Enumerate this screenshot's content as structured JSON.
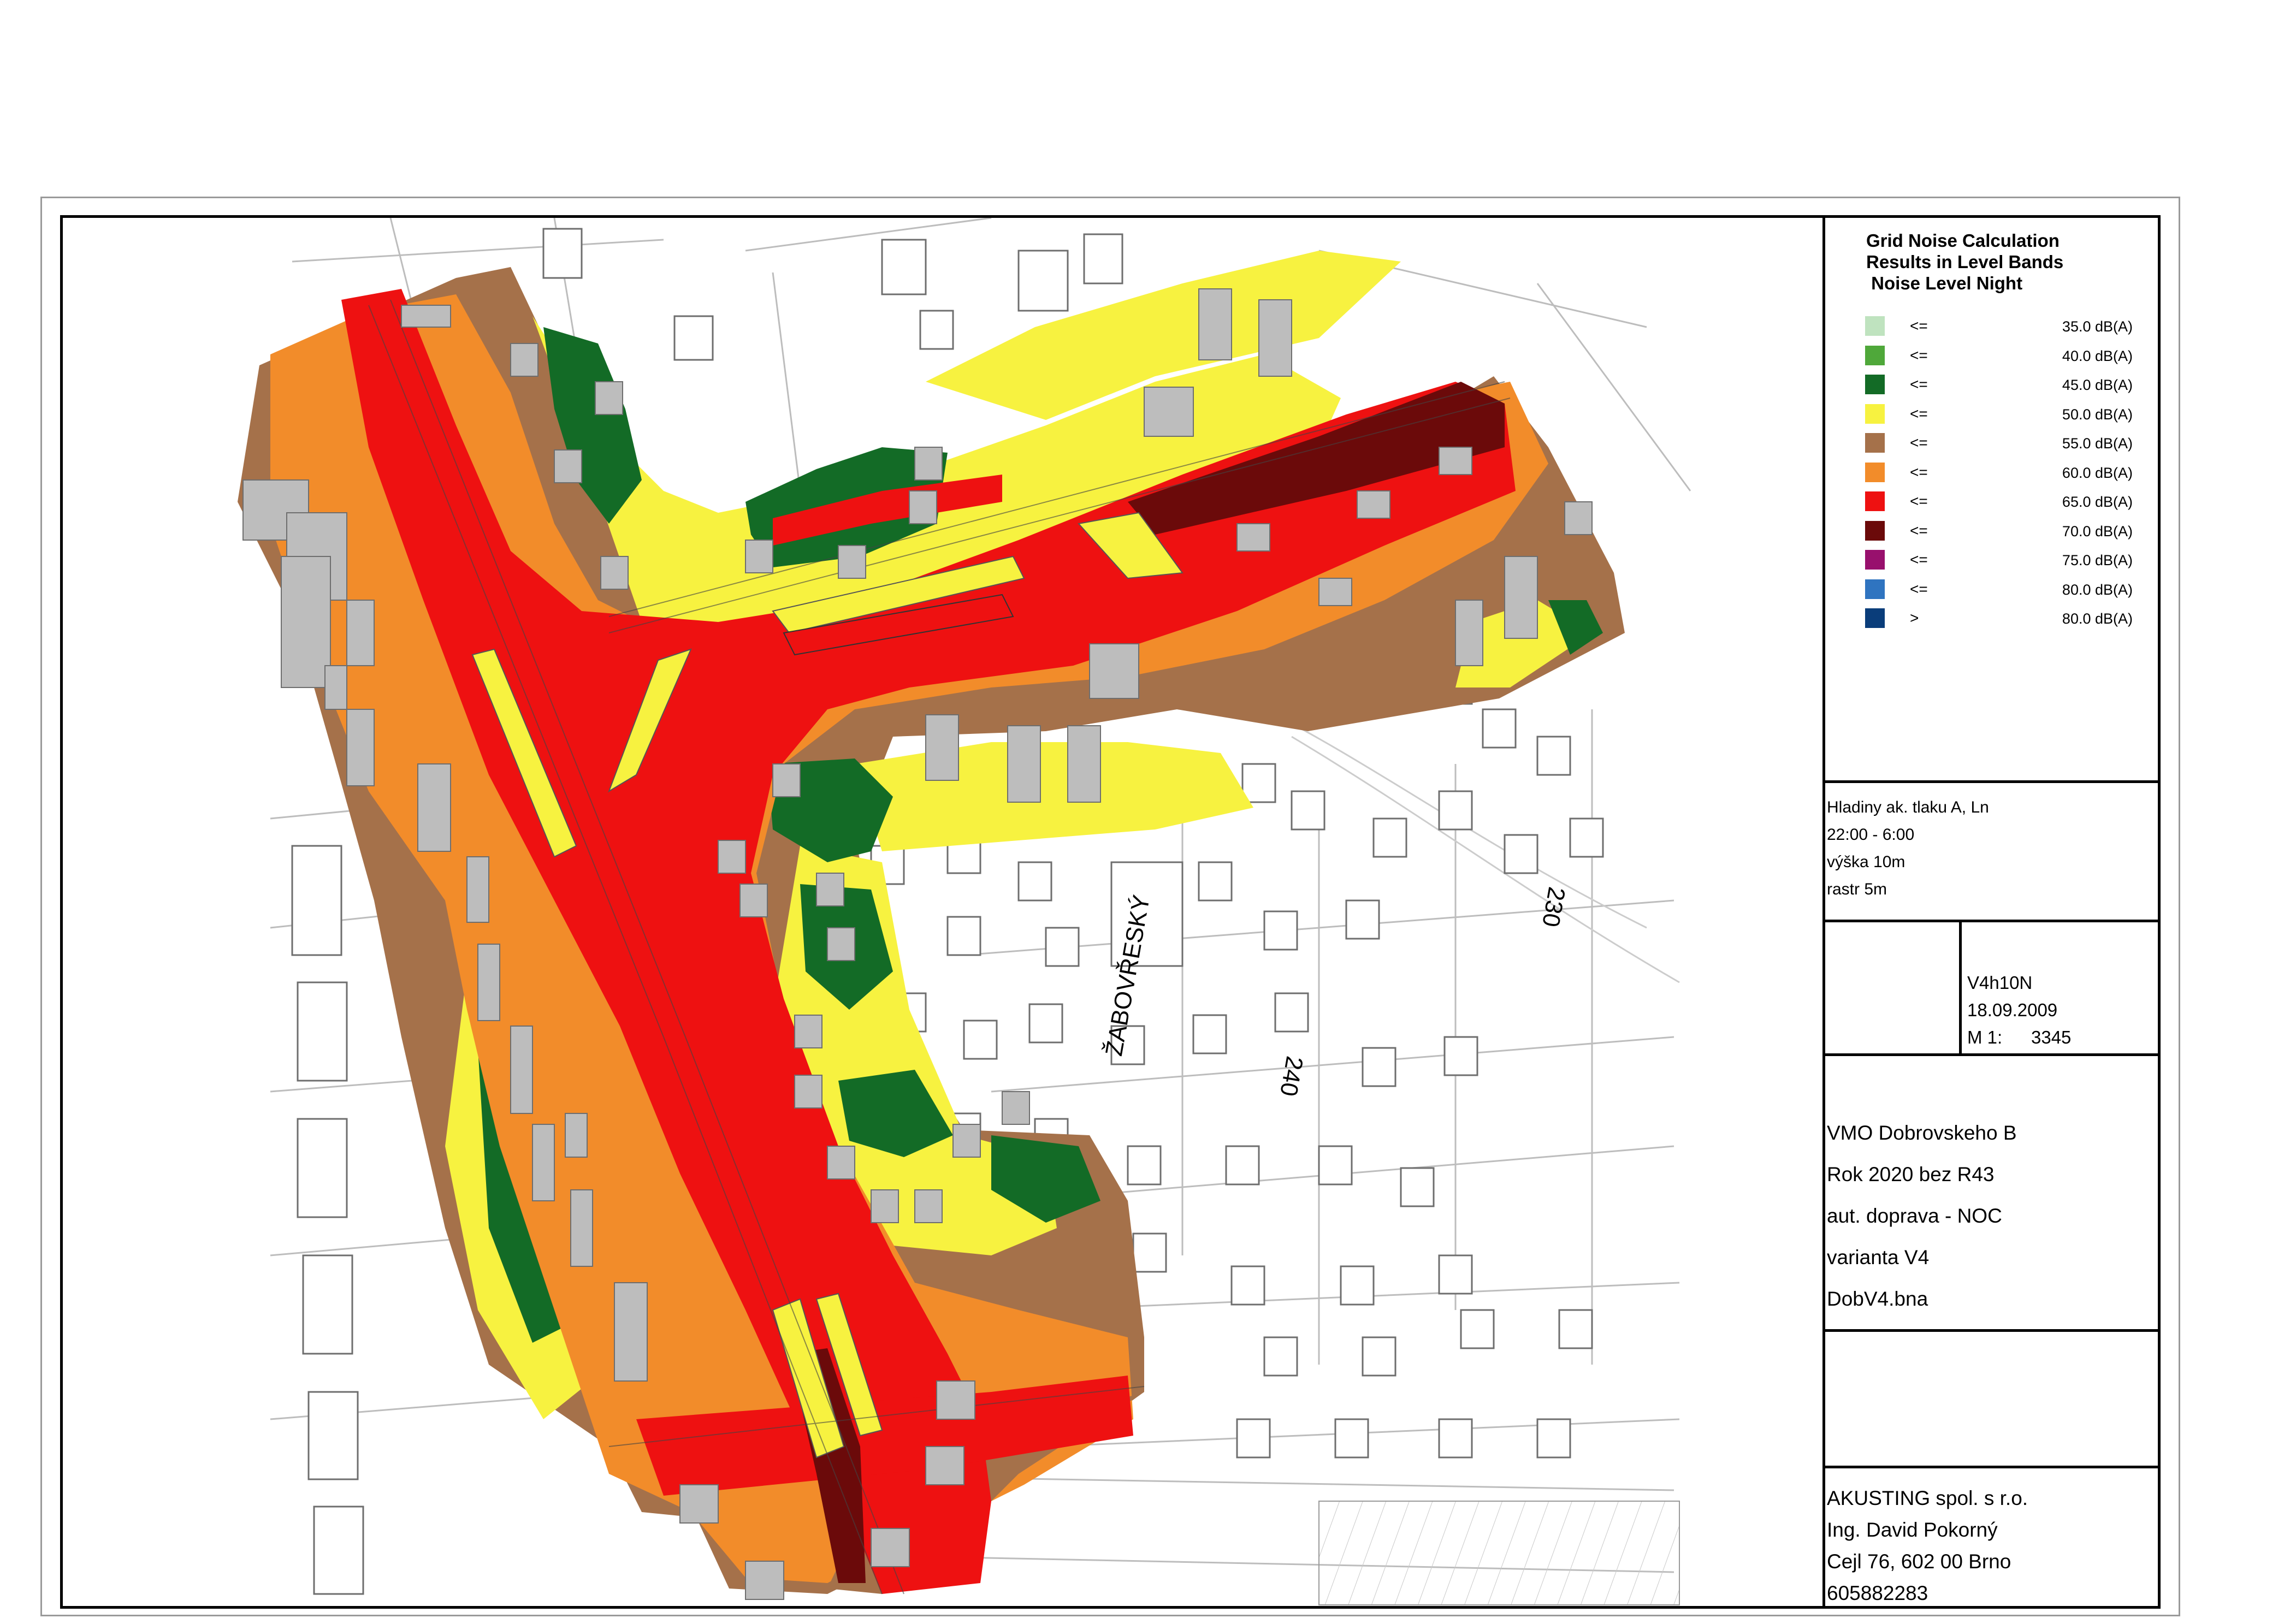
{
  "legend": {
    "title": "Grid Noise Calculation\nResults in Level Bands\n Noise Level Night",
    "bands": [
      {
        "op": "<=",
        "value": "35.0 dB(A)",
        "color": "#bfe3bf"
      },
      {
        "op": "<=",
        "value": "40.0 dB(A)",
        "color": "#4fa83a"
      },
      {
        "op": "<=",
        "value": "45.0 dB(A)",
        "color": "#136b26"
      },
      {
        "op": "<=",
        "value": "50.0 dB(A)",
        "color": "#f7f240"
      },
      {
        "op": "<=",
        "value": "55.0 dB(A)",
        "color": "#a5714a"
      },
      {
        "op": "<=",
        "value": "60.0 dB(A)",
        "color": "#f28c2a"
      },
      {
        "op": "<=",
        "value": "65.0 dB(A)",
        "color": "#ee1111"
      },
      {
        "op": "<=",
        "value": "70.0 dB(A)",
        "color": "#6b0a0a"
      },
      {
        "op": "<=",
        "value": "75.0 dB(A)",
        "color": "#98106d"
      },
      {
        "op": "<=",
        "value": "80.0 dB(A)",
        "color": "#2f74c0"
      },
      {
        "op": ">",
        "value": "80.0 dB(A)",
        "color": "#0a3d7a"
      }
    ]
  },
  "params": {
    "line1": "Hladiny ak. tlaku A, Ln",
    "line2": "22:00 - 6:00",
    "line3": "výška 10m",
    "line4": "rastr 5m"
  },
  "drawing": {
    "code": "V4h10N",
    "date": "18.09.2009",
    "scale_label": "M 1:",
    "scale_value": "3345"
  },
  "project": {
    "line1": "VMO Dobrovskeho B",
    "line2": "Rok 2020 bez R43",
    "line3": "aut. doprava - NOC",
    "line4": "varianta V4",
    "line5": "DobV4.bna"
  },
  "company": {
    "line1": "AKUSTING spol. s r.o.",
    "line2": "Ing. David Pokorný",
    "line3": "Cejl 76, 602 00 Brno",
    "line4": "605882283"
  },
  "map_labels": {
    "street": "ŽABOVŘESKÝ",
    "label_230": "230",
    "label_240": "240"
  }
}
